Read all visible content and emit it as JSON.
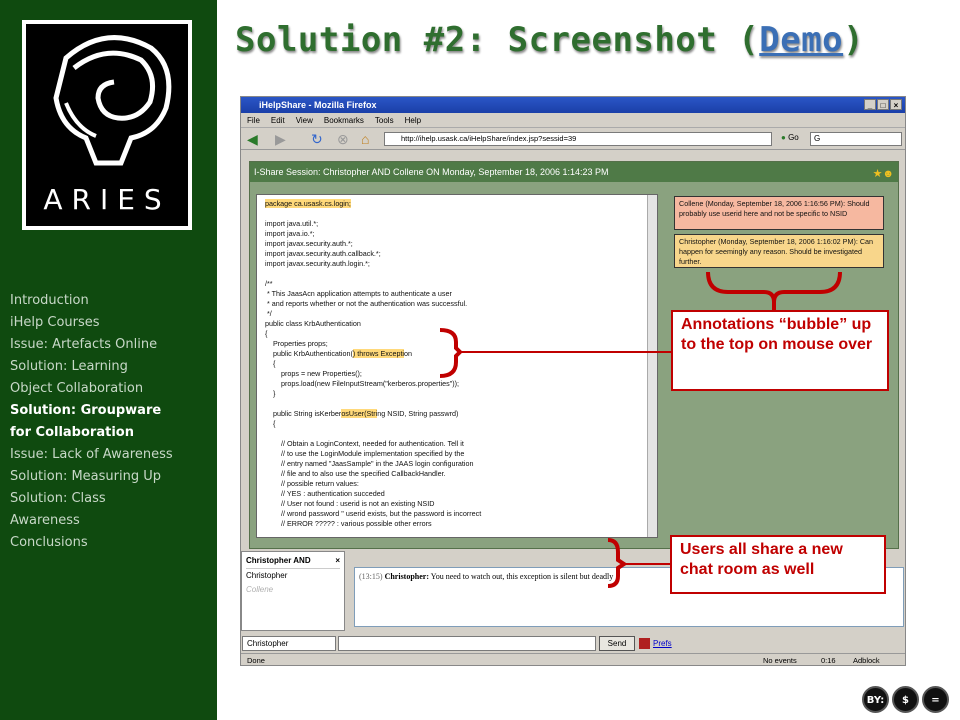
{
  "sidebar": {
    "logo_text": "ARIES",
    "nav": [
      {
        "label": "Introduction",
        "active": false
      },
      {
        "label": "iHelp Courses",
        "active": false
      },
      {
        "label": "Issue: Artefacts Online",
        "active": false
      },
      {
        "label": "Solution: Learning",
        "active": false
      },
      {
        "label": "Object Collaboration",
        "active": false
      },
      {
        "label": "Solution: Groupware",
        "active": true
      },
      {
        "label": "for Collaboration",
        "active": true
      },
      {
        "label": "Issue: Lack of Awareness",
        "active": false
      },
      {
        "label": "Solution: Measuring Up",
        "active": false
      },
      {
        "label": "Solution: Class",
        "active": false
      },
      {
        "label": "Awareness",
        "active": false
      },
      {
        "label": "Conclusions",
        "active": false
      }
    ]
  },
  "slide": {
    "title_prefix": "Solution #2: Screenshot (",
    "title_link": "Demo",
    "title_suffix": ")"
  },
  "browser": {
    "window_title": "iHelpShare - Mozilla Firefox",
    "menu": [
      "File",
      "Edit",
      "View",
      "Bookmarks",
      "Tools",
      "Help"
    ],
    "url": "http://ihelp.usask.ca/iHelpShare/index.jsp?sessid=39",
    "go_label": "Go",
    "search_value": "G",
    "status": {
      "left": "Done",
      "events": "No events",
      "time": "0:16",
      "adblock": "Adblock"
    }
  },
  "ishare": {
    "header": "I-Share Session: Christopher AND Collene ON Monday, September 18, 2006 1:14:23 PM",
    "code_lines": [
      "package ca.usask.cs.login;",
      "",
      "import java.util.*;",
      "import java.io.*;",
      "import javax.security.auth.*;",
      "import javax.security.auth.callback.*;",
      "import javax.security.auth.login.*;",
      "",
      "/**",
      " * This JaasAcn application attempts to authenticate a user",
      " * and reports whether or not the authentication was successful.",
      " */",
      "public class KrbAuthentication",
      "{",
      "    Properties props;",
      "    public KrbAuthentication() throws Exception",
      "    {",
      "        props = new Properties();",
      "        props.load(new FileInputStream(\"kerberos.properties\"));",
      "    }",
      "",
      "    public String isKerberosUser(String NSID, String passwrd)",
      "    {",
      "",
      "        // Obtain a LoginContext, needed for authentication. Tell it",
      "        // to use the LoginModule implementation specified by the",
      "        // entry named \"JaasSample\" in the JAAS login configuration",
      "        // file and to also use the specified CallbackHandler.",
      "        // possible return values:",
      "        // YES : authentication succeded",
      "        // User not found : userid is not an existing NSID",
      "        // wrond password \" userid exists, but the password is incorrect",
      "        // ERROR ????? : various possible other errors"
    ],
    "annotations": [
      "Collene (Monday, September 18, 2006 1:16:56 PM): Should probably use userid here and not be specific to NSID",
      "Christopher (Monday, September 18, 2006 1:16:02 PM): Can happen for seemingly any reason. Should be investigated further."
    ]
  },
  "chat": {
    "room_title": "Christopher AND",
    "close": "×",
    "users": [
      "Christopher",
      "Collene"
    ],
    "message_time": "(13:15)",
    "message_user": "Christopher:",
    "message_text": "You need to watch out, this exception is silent but deadly",
    "nickname": "Christopher",
    "send_label": "Send",
    "prefs_label": "Prefs"
  },
  "callouts": {
    "annotations": "Annotations “bubble” up to the top on mouse over",
    "chat": "Users all share a new chat room as well"
  },
  "license": [
    "BY:",
    "$",
    "="
  ],
  "colors": {
    "sidebar": "#0f4a0f",
    "title": "#2f6e2f",
    "callout": "#c00000",
    "ishare_bg": "#8aa27f"
  }
}
